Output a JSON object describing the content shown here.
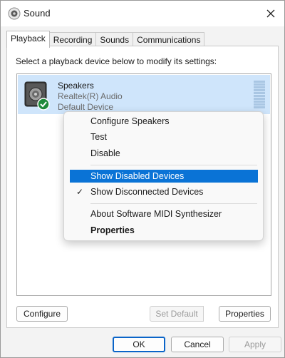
{
  "window": {
    "title": "Sound",
    "icon": "speaker-app-icon",
    "close_icon": "close-icon"
  },
  "tabs": [
    {
      "label": "Playback",
      "active": true
    },
    {
      "label": "Recording",
      "active": false
    },
    {
      "label": "Sounds",
      "active": false
    },
    {
      "label": "Communications",
      "active": false
    }
  ],
  "playback": {
    "instruction": "Select a playback device below to modify its settings:",
    "device": {
      "name": "Speakers",
      "driver": "Realtek(R) Audio",
      "status": "Default Device",
      "icon": "speaker-device-icon",
      "status_icon": "green-check-icon"
    }
  },
  "context_menu": {
    "items": [
      {
        "label": "Configure Speakers"
      },
      {
        "label": "Test"
      },
      {
        "label": "Disable"
      },
      {
        "label": "Show Disabled Devices",
        "highlighted": true
      },
      {
        "label": "Show Disconnected Devices",
        "checked": true
      },
      {
        "label": "About Software MIDI Synthesizer"
      },
      {
        "label": "Properties",
        "bold": true
      }
    ],
    "check_glyph": "✓"
  },
  "buttons": {
    "configure": "Configure",
    "set_default": "Set Default",
    "properties": "Properties",
    "ok": "OK",
    "cancel": "Cancel",
    "apply": "Apply"
  },
  "colors": {
    "selection": "#cfe5fb",
    "highlight": "#0a73d6",
    "default_button_border": "#0a64c8",
    "status_green": "#1f8a3a"
  }
}
